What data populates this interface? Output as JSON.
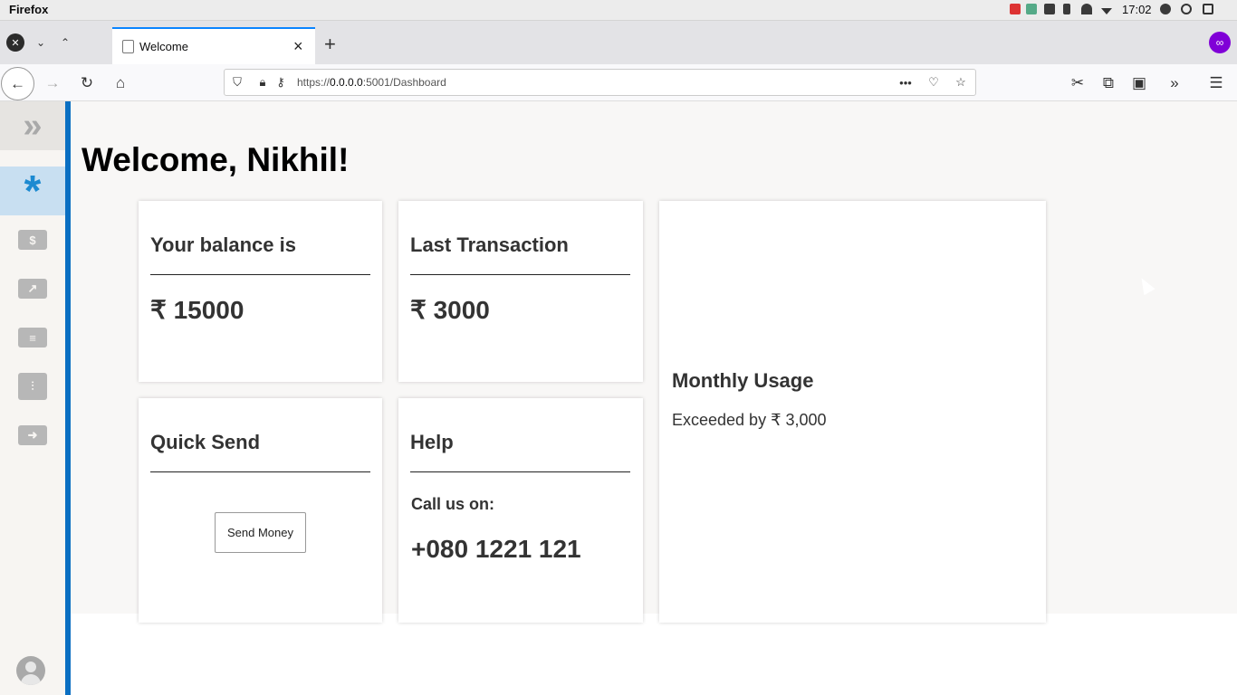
{
  "os_bar": {
    "app_name": "Firefox",
    "clock": "17:02"
  },
  "browser": {
    "tab_title": "Welcome",
    "url_prefix": "https://",
    "url_host": "0.0.0.0",
    "url_rest": ":5001/Dashboard",
    "new_tab_symbol": "+"
  },
  "sidebar": {
    "items": [
      {
        "name": "expand",
        "icon": "double-chevron-right-icon"
      },
      {
        "name": "dashboard",
        "icon": "asterisk-icon",
        "active": true
      },
      {
        "name": "payments",
        "icon": "bill-icon",
        "glyph": "$"
      },
      {
        "name": "analytics",
        "icon": "trend-chart-icon",
        "glyph": "↗"
      },
      {
        "name": "transactions",
        "icon": "list-icon",
        "glyph": "≡"
      },
      {
        "name": "settings",
        "icon": "sliders-icon",
        "glyph": "⫶"
      },
      {
        "name": "logout",
        "icon": "logout-icon",
        "glyph": "➜"
      }
    ]
  },
  "page": {
    "heading": "Welcome, Nikhil!"
  },
  "cards": {
    "balance": {
      "title": "Your balance is",
      "value": "₹ 15000"
    },
    "last_transaction": {
      "title": "Last Transaction",
      "value": "₹ 3000"
    },
    "quick_send": {
      "title": "Quick Send",
      "button_label": "Send Money"
    },
    "help": {
      "title": "Help",
      "call_label": "Call us on:",
      "phone": "+080 1221 121"
    },
    "monthly_usage": {
      "title": "Monthly Usage",
      "status": "Exceeded by ₹ 3,000"
    }
  },
  "colors": {
    "accent": "#0a6fc2",
    "sidebar_active": "#1c8ad1",
    "tab_accent": "#0a84ff"
  }
}
